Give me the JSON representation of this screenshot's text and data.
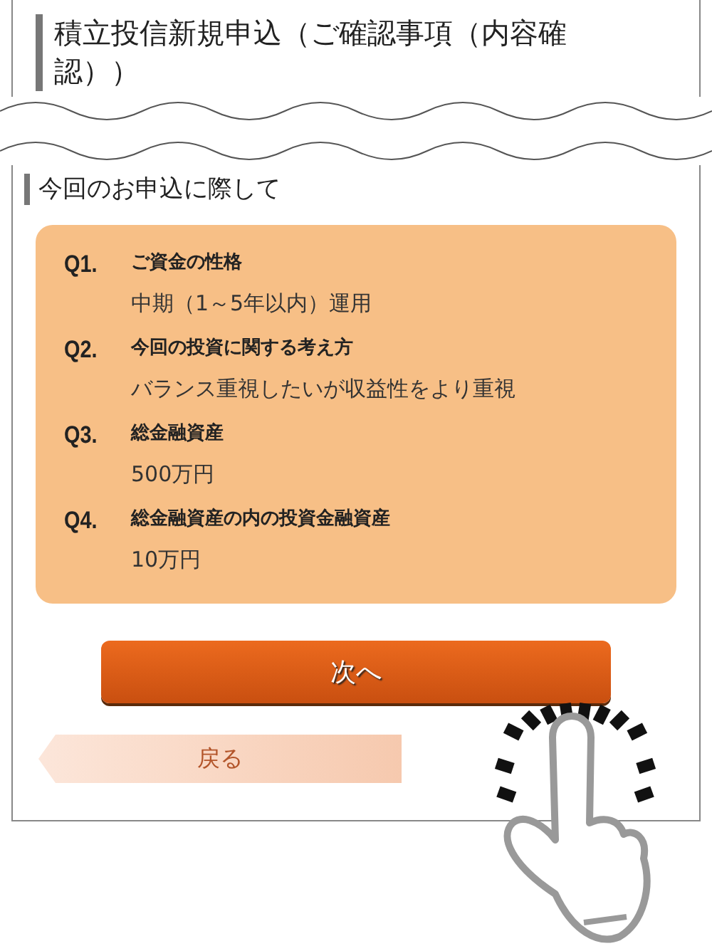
{
  "page_title": "積立投信新規申込（ご確認事項（内容確認））",
  "section": {
    "heading": "今回のお申込に際して"
  },
  "questions": [
    {
      "number": "Q1.",
      "question": "ご資金の性格",
      "answer": "中期（1～5年以内）運用"
    },
    {
      "number": "Q2.",
      "question": "今回の投資に関する考え方",
      "answer": "バランス重視したいが収益性をより重視"
    },
    {
      "number": "Q3.",
      "question": "総金融資産",
      "answer": "500万円"
    },
    {
      "number": "Q4.",
      "question": "総金融資産の内の投資金融資産",
      "answer": "10万円"
    }
  ],
  "buttons": [
    {
      "kind": "primary",
      "label": "次へ"
    },
    {
      "kind": "back",
      "label": "戻る"
    }
  ]
}
